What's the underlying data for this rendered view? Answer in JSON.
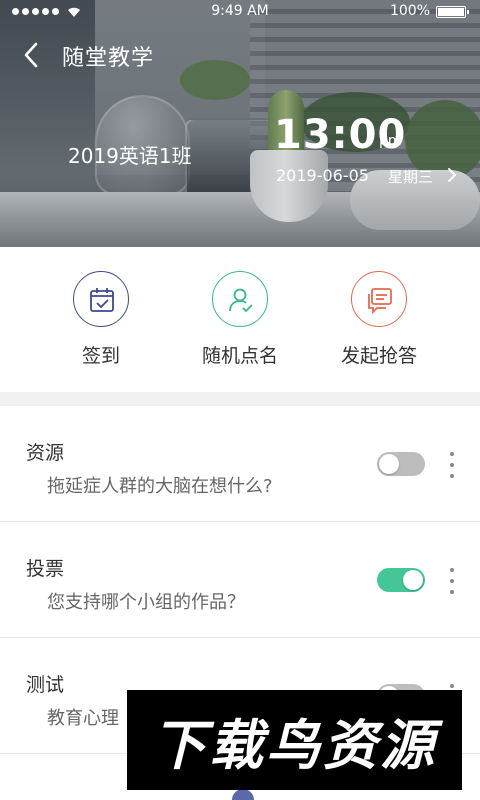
{
  "status_bar": {
    "time": "9:49 AM",
    "battery": "100%"
  },
  "nav": {
    "title": "随堂教学"
  },
  "hero": {
    "class_name": "2019英语1班",
    "clock": "13:00",
    "ampm": "pm",
    "date": "2019-06-05",
    "weekday": "星期三"
  },
  "actions": [
    {
      "label": "签到",
      "icon": "calendar-check-icon",
      "color": "#3b4a8f"
    },
    {
      "label": "随机点名",
      "icon": "user-check-icon",
      "color": "#34b98a"
    },
    {
      "label": "发起抢答",
      "icon": "chat-icon",
      "color": "#e26a4e"
    }
  ],
  "list": [
    {
      "title": "资源",
      "subtitle": "拖延症人群的大脑在想什么?",
      "toggle_on": false
    },
    {
      "title": "投票",
      "subtitle": "您支持哪个小组的作品？",
      "toggle_on": true
    },
    {
      "title": "测试",
      "subtitle": "教育心理",
      "toggle_on": false
    }
  ],
  "watermark": "下载鸟资源",
  "colors": {
    "toggle_on": "#44c697",
    "toggle_off": "#bdbdbd"
  }
}
